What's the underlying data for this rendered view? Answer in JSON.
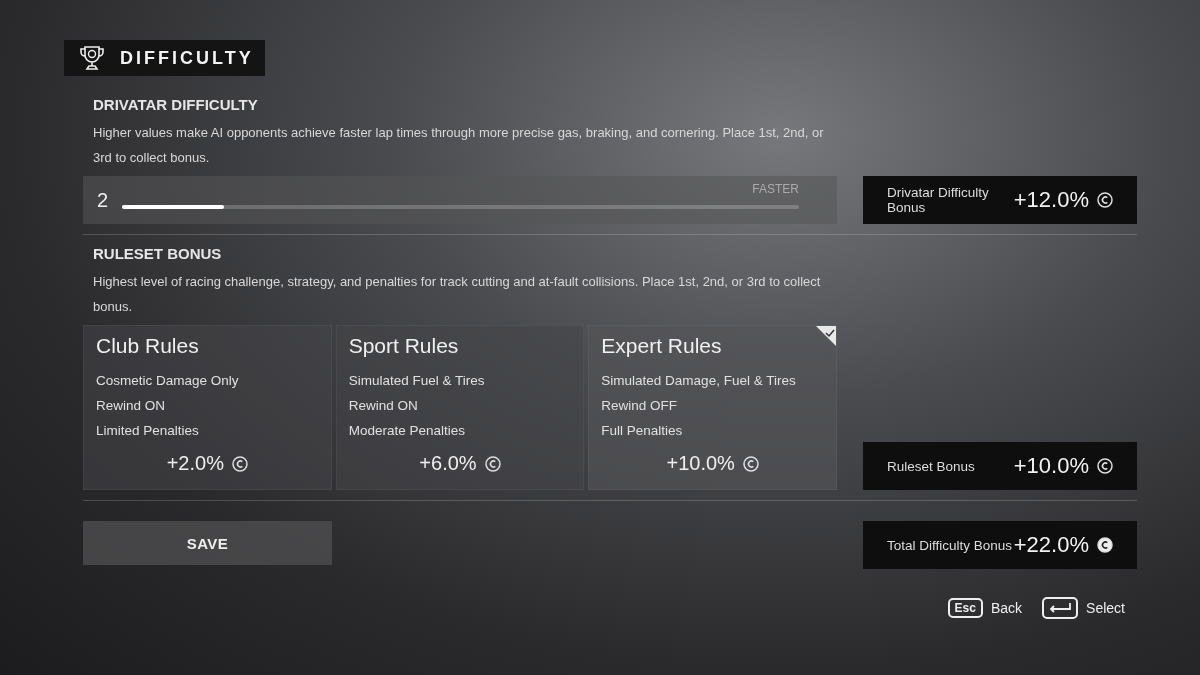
{
  "header": {
    "title": "DIFFICULTY"
  },
  "drivatar": {
    "heading": "DRIVATAR DIFFICULTY",
    "description": "Higher values make AI opponents achieve faster lap times through more precise gas, braking, and cornering. Place 1st, 2nd, or 3rd to collect bonus.",
    "value": "2",
    "level": 0.15,
    "end_label": "FASTER",
    "bonus": {
      "label": "Drivatar Difficulty Bonus",
      "value": "+12.0%"
    }
  },
  "ruleset": {
    "heading": "RULESET BONUS",
    "description": "Highest level of racing challenge, strategy, and penalties for track cutting and at-fault collisions. Place 1st, 2nd, or 3rd to collect bonus.",
    "cards": [
      {
        "title": "Club Rules",
        "lines": [
          "Cosmetic Damage Only",
          "Rewind ON",
          "Limited Penalties"
        ],
        "bonus": "+2.0%",
        "selected": false
      },
      {
        "title": "Sport Rules",
        "lines": [
          "Simulated Fuel & Tires",
          "Rewind ON",
          "Moderate Penalties"
        ],
        "bonus": "+6.0%",
        "selected": false
      },
      {
        "title": "Expert Rules",
        "lines": [
          "Simulated Damage, Fuel & Tires",
          "Rewind OFF",
          "Full Penalties"
        ],
        "bonus": "+10.0%",
        "selected": true
      }
    ],
    "bonus": {
      "label": "Ruleset Bonus",
      "value": "+10.0%"
    }
  },
  "save_button": "SAVE",
  "total": {
    "label": "Total Difficulty Bonus",
    "value": "+22.0%"
  },
  "hints": [
    {
      "kind": "key",
      "key": "Esc",
      "label": "Back"
    },
    {
      "kind": "enter",
      "label": "Select"
    }
  ]
}
